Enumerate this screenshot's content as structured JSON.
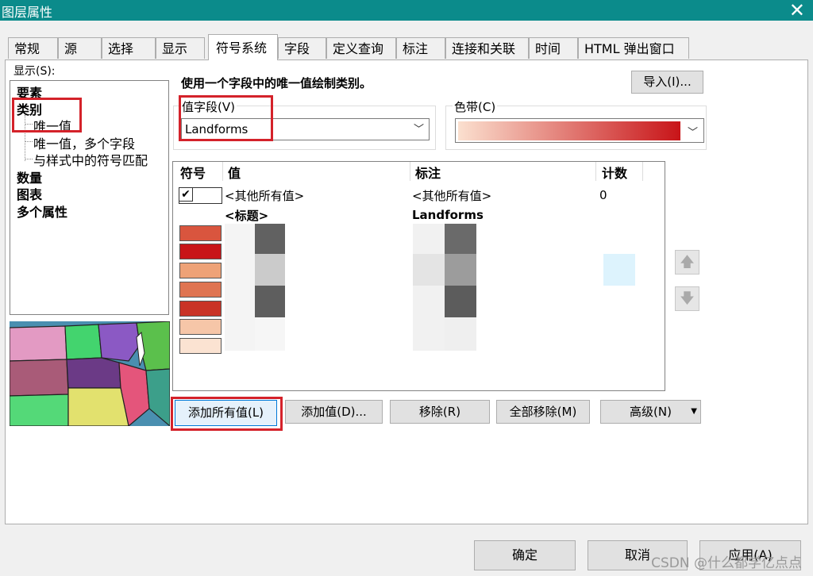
{
  "window": {
    "title": "图层属性",
    "close_icon": "close-icon"
  },
  "tabs": [
    "常规",
    "源",
    "选择",
    "显示",
    "符号系统",
    "字段",
    "定义查询",
    "标注",
    "连接和关联",
    "时间",
    "HTML 弹出窗口"
  ],
  "active_tab": "符号系统",
  "show": {
    "label": "显示(S):",
    "items": [
      "要素",
      "类别",
      "唯一值",
      "唯一值，多个字段",
      "与样式中的符号匹配",
      "数量",
      "图表",
      "多个属性"
    ],
    "selected": "唯一值"
  },
  "description": "使用一个字段中的唯一值绘制类别。",
  "import_button": "导入(I)...",
  "value_field": {
    "label": "值字段(V)",
    "value": "Landforms"
  },
  "color_ramp": {
    "label": "色带(C)",
    "start_color": "#fbe0cf",
    "end_color": "#c81418"
  },
  "list": {
    "headers": {
      "symbol": "符号",
      "value": "值",
      "label": "标注",
      "count": "计数"
    },
    "other_row": {
      "value": "<其他所有值>",
      "label": "<其他所有值>",
      "count": "0",
      "checked": true
    },
    "heading_row": {
      "value": "<标题>",
      "label": "Landforms"
    },
    "swatch_colors": [
      "#d9553e",
      "#c81418",
      "#eea277",
      "#df7451",
      "#c93326",
      "#f6c6a8",
      "#fbe3d2"
    ]
  },
  "buttons": {
    "add_all": "添加所有值(L)",
    "add": "添加值(D)...",
    "remove": "移除(R)",
    "remove_all": "全部移除(M)",
    "advanced": "高级(N)"
  },
  "footer": {
    "ok": "确定",
    "cancel": "取消",
    "apply": "应用(A)"
  },
  "watermark": "CSDN @什么都学亿点点"
}
